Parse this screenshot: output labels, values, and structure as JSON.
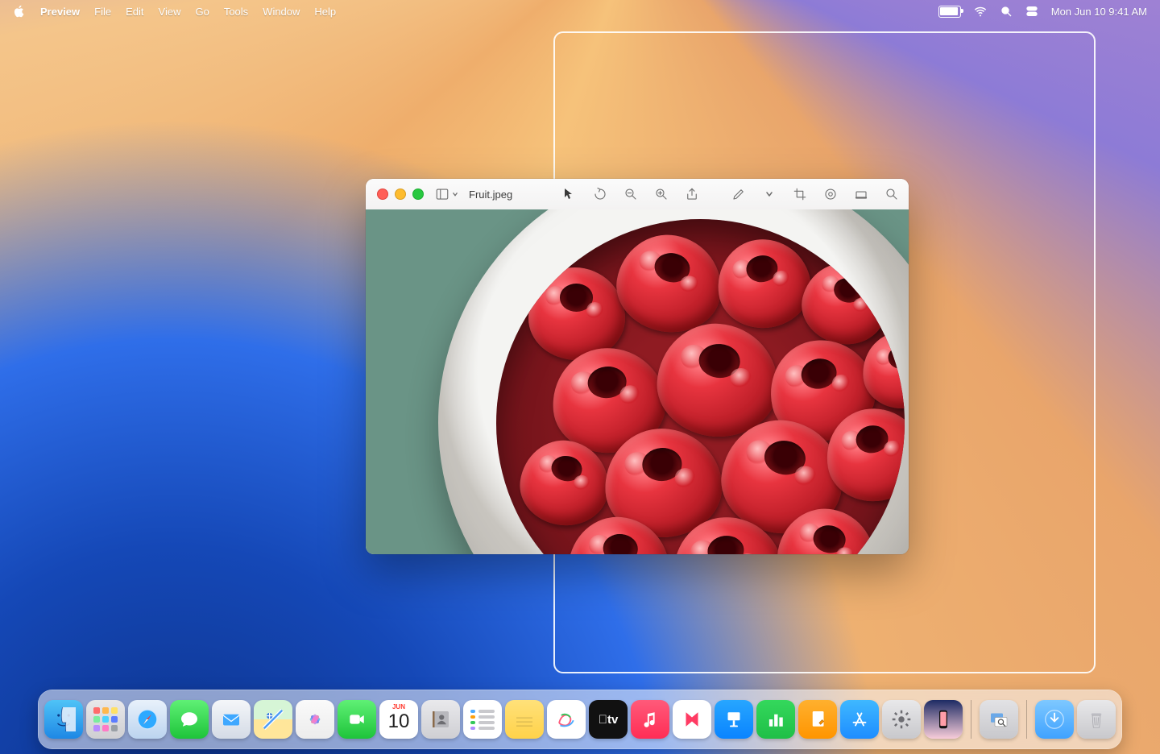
{
  "menubar": {
    "app": "Preview",
    "items": [
      "File",
      "Edit",
      "View",
      "Go",
      "Tools",
      "Window",
      "Help"
    ],
    "clock": "Mon Jun 10  9:41 AM"
  },
  "window": {
    "title": "Fruit.jpeg",
    "toolbar": {
      "cursor": "Selection",
      "rotate": "Rotate Left",
      "zoom_in": "Zoom In",
      "zoom_out": "Zoom Out",
      "share": "Share",
      "markup": "Markup",
      "more": "More",
      "crop": "Crop",
      "adjust": "Adjust Color",
      "highlight": "Highlight",
      "search": "Search"
    }
  },
  "calendar": {
    "month": "JUN",
    "day": "10"
  },
  "dock": [
    {
      "name": "finder",
      "label": "Finder"
    },
    {
      "name": "launchpad",
      "label": "Launchpad"
    },
    {
      "name": "safari",
      "label": "Safari"
    },
    {
      "name": "messages",
      "label": "Messages"
    },
    {
      "name": "mail",
      "label": "Mail"
    },
    {
      "name": "maps",
      "label": "Maps"
    },
    {
      "name": "photos",
      "label": "Photos"
    },
    {
      "name": "facetime",
      "label": "FaceTime"
    },
    {
      "name": "calendar",
      "label": "Calendar"
    },
    {
      "name": "contacts",
      "label": "Contacts"
    },
    {
      "name": "reminders",
      "label": "Reminders"
    },
    {
      "name": "notes",
      "label": "Notes"
    },
    {
      "name": "freeform",
      "label": "Freeform"
    },
    {
      "name": "tv",
      "label": "TV"
    },
    {
      "name": "music",
      "label": "Music"
    },
    {
      "name": "news",
      "label": "News"
    },
    {
      "name": "keynote",
      "label": "Keynote"
    },
    {
      "name": "numbers",
      "label": "Numbers"
    },
    {
      "name": "pages",
      "label": "Pages"
    },
    {
      "name": "appstore",
      "label": "App Store"
    },
    {
      "name": "settings",
      "label": "System Settings"
    },
    {
      "name": "mirror",
      "label": "iPhone Mirroring"
    }
  ]
}
